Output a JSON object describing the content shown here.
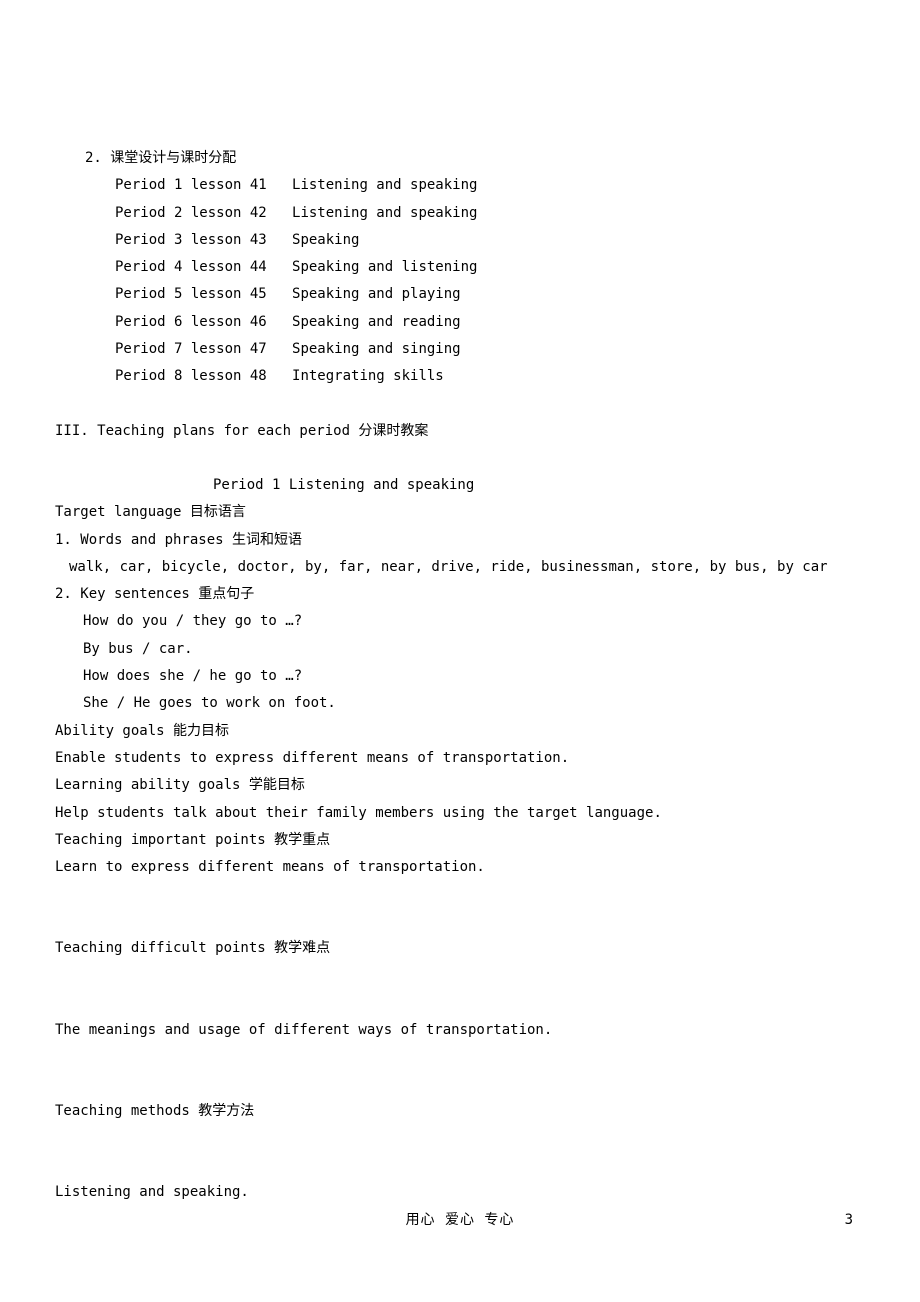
{
  "section2": {
    "title": "2. 课堂设计与课时分配",
    "periods": [
      {
        "period": "Period 1 lesson 41",
        "desc": "Listening and speaking"
      },
      {
        "period": "Period 2 lesson 42",
        "desc": "Listening and speaking"
      },
      {
        "period": "Period 3 lesson 43",
        "desc": "Speaking"
      },
      {
        "period": "Period 4 lesson 44",
        "desc": "Speaking and listening"
      },
      {
        "period": "Period 5 lesson 45",
        "desc": "Speaking and playing"
      },
      {
        "period": "Period 6 lesson 46",
        "desc": "Speaking and reading"
      },
      {
        "period": "Period 7 lesson 47",
        "desc": "Speaking and singing"
      },
      {
        "period": "Period 8 lesson 48",
        "desc": "Integrating skills"
      }
    ]
  },
  "section3": {
    "heading": "III. Teaching plans for each period 分课时教案",
    "period_title": "Period 1 Listening and speaking",
    "target_language_heading": "Target language 目标语言",
    "words_heading": "1. Words and phrases 生词和短语",
    "words_content": "walk, car, bicycle, doctor, by, far, near, drive, ride, businessman, store, by bus, by car",
    "key_sentences_heading": "2. Key sentences 重点句子",
    "key_sentences": [
      "How do you / they go to …?",
      "By bus / car.",
      "How does she / he go to …?",
      "She / He goes to work on foot."
    ],
    "ability_goals_heading": "Ability goals 能力目标",
    "ability_goals_content": "Enable students to express different means of transportation.",
    "learning_goals_heading": "Learning ability goals 学能目标",
    "learning_goals_content": "Help students talk about their family members using the target language.",
    "important_points_heading": "Teaching important points 教学重点",
    "important_points_content": "Learn to express different means of transportation.",
    "difficult_points_heading": "Teaching difficult points 教学难点",
    "difficult_points_content": "The meanings and usage of different ways of transportation.",
    "methods_heading": "Teaching methods 教学方法",
    "methods_content": "Listening and speaking."
  },
  "footer": {
    "center_text": "用心   爱心   专心",
    "page_number": "3"
  }
}
